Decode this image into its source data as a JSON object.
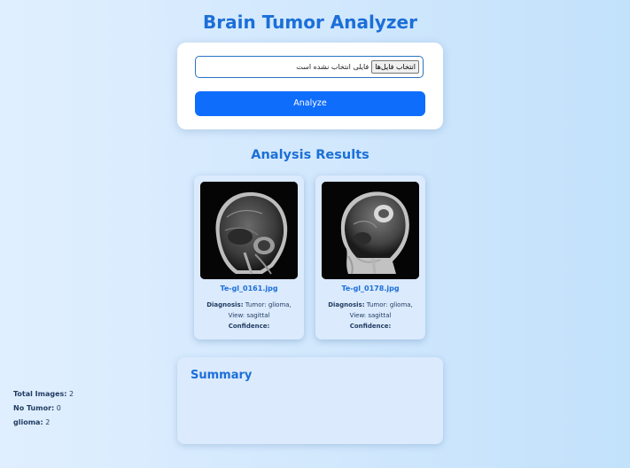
{
  "header": {
    "title": "Brain Tumor Analyzer"
  },
  "upload": {
    "choose_button": "انتخاب فایل‌ها",
    "file_status": "فایلی انتخاب نشده است",
    "analyze_button": "Analyze"
  },
  "results": {
    "title": "Analysis Results",
    "diagnosis_label": "Diagnosis:",
    "confidence_label": "Confidence:",
    "items": [
      {
        "filename": "Te-gl_0161.jpg",
        "diagnosis": "Tumor: glioma, View: sagittal",
        "confidence": ""
      },
      {
        "filename": "Te-gl_0178.jpg",
        "diagnosis": "Tumor: glioma, View: sagittal",
        "confidence": ""
      }
    ]
  },
  "summary": {
    "title": "Summary",
    "total_label": "Total Images:",
    "total_value": "2",
    "no_tumor_label": "No Tumor:",
    "no_tumor_value": "0",
    "glioma_label": "glioma:",
    "glioma_value": "2"
  },
  "colors": {
    "accent": "#1b6fd8",
    "button": "#0f6dfc",
    "card_background": "#dbeafd"
  }
}
